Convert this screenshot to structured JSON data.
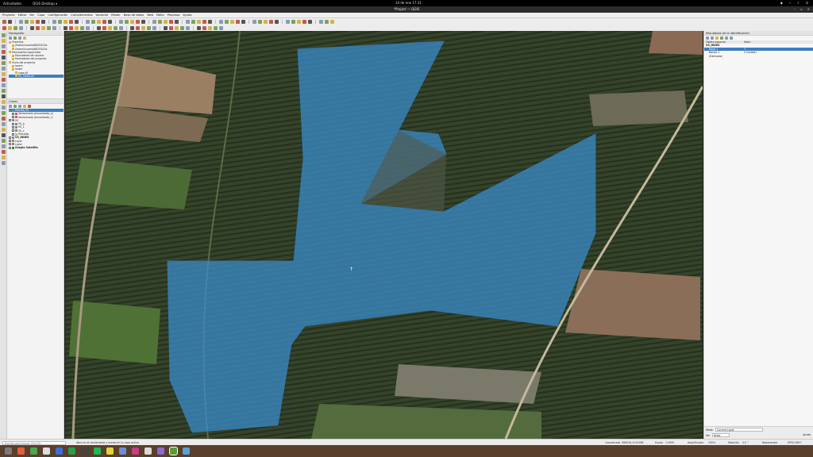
{
  "system": {
    "activities": "Actividades",
    "app_name": "QGIS Desktop ▾",
    "clock": "14 de ene 17:31"
  },
  "window": {
    "title": "*Project — QGIS"
  },
  "menu": [
    "Proyecto",
    "Editar",
    "Ver",
    "Capa",
    "Configuración",
    "Complementos",
    "Vectorial",
    "Ráster",
    "Base de datos",
    "Web",
    "Malla",
    "Procesos",
    "Ayuda"
  ],
  "navigator": {
    "title": "Navegador",
    "items": [
      {
        "label": "Favoritos",
        "indent": 0
      },
      {
        "label": "/home/usuario/NIDOS/Gis",
        "indent": 1
      },
      {
        "label": "/home/usuario/NIDOS/Gis",
        "indent": 1
      },
      {
        "label": "Marcadores espaciales",
        "indent": 0
      },
      {
        "label": "Marcadores de usuario",
        "indent": 1
      },
      {
        "label": "Marcadores del proyecto",
        "indent": 1
      },
      {
        "label": "Inicio del proyecto",
        "indent": 0
      },
      {
        "label": "layers",
        "indent": 1
      },
      {
        "label": "raster",
        "indent": 1
      },
      {
        "label": "capa.tif",
        "indent": 2
      },
      {
        "label": "VS_Indice.tif",
        "indent": 2
      }
    ],
    "selected_index": 10
  },
  "layers_panel": {
    "title": "Capas",
    "items": [
      {
        "label": "Parcela_VS",
        "indent": 0,
        "color": "#4a8fc4",
        "selected": true
      },
      {
        "label": "Vectorizado (encontrado_o)",
        "indent": 1,
        "color": "#c25b8b"
      },
      {
        "label": "Vectorizado (encontrado_1)",
        "indent": 1,
        "color": "#c25b8b"
      },
      {
        "label": "VS",
        "indent": 0,
        "color": "#888"
      },
      {
        "label": "VS_a",
        "indent": 1,
        "color": "#888"
      },
      {
        "label": "VS_1",
        "indent": 1,
        "color": "#888"
      },
      {
        "label": "VS_c",
        "indent": 1,
        "color": "#888"
      },
      {
        "label": "Parcelas",
        "indent": 1,
        "color": "#d7b34a"
      },
      {
        "label": "VS_INDEX",
        "indent": 0,
        "color": "#888"
      },
      {
        "label": "Layer",
        "indent": 0,
        "color": "#888"
      },
      {
        "label": "Layer",
        "indent": 0,
        "color": "#888"
      },
      {
        "label": "Google Satellite",
        "indent": 0,
        "color": "#3a8a3a"
      }
    ]
  },
  "identify_panel": {
    "title": "Resultados de la identificación",
    "col_feature": "Objeto espacial",
    "col_value": "Valor",
    "rows": [
      {
        "k": "VS_INDEX",
        "v": "",
        "bold": true
      },
      {
        "k": "Band 1",
        "v": "1",
        "selected": true
      },
      {
        "k": "Banda 1",
        "v": "5 (visible)"
      },
      {
        "k": "(Derivado)",
        "v": ""
      }
    ],
    "mode_label": "Modo",
    "mode_value": "Current Layer",
    "view_label": "Ver",
    "view_value": "Árbol",
    "help": "Ayuda"
  },
  "status": {
    "search_placeholder": "Escriba para buscar (Ctrl+K)",
    "message": "Abra en el renderizado y escale en la capa activa",
    "coord_label": "Coordenada",
    "coord_value": "566528,4119188",
    "scale_label": "Escala",
    "scale_value": "1:5000",
    "magnifier_label": "Amplificador",
    "magnifier_value": "100%",
    "rotation_label": "Rotación",
    "rotation_value": "0,0 °",
    "render_label": "Representar",
    "crs": "EPSG:3857"
  },
  "colors": {
    "polygon_fill": "#3a8fd0",
    "selection": "#3d7fc1",
    "road": "#b8ad92"
  }
}
